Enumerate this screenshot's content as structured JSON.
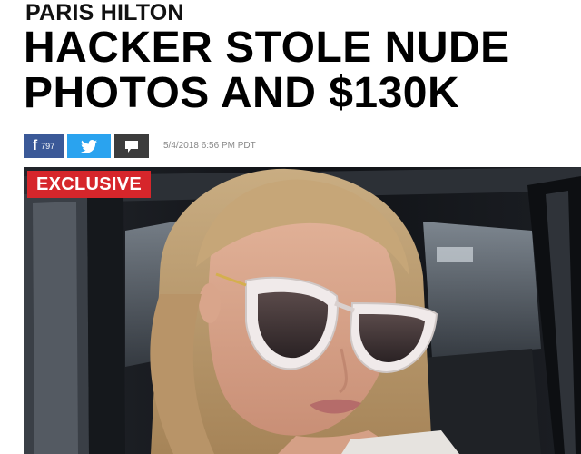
{
  "article": {
    "kicker": "PARIS HILTON",
    "headline": "HACKER STOLE NUDE PHOTOS AND $130K",
    "timestamp": "5/4/2018 6:56 PM PDT",
    "badge": "EXCLUSIVE"
  },
  "share": {
    "facebook_glyph": "f",
    "facebook_count": "797",
    "twitter_icon": "twitter-bird-icon",
    "comment_icon": "comment-bubble-icon"
  },
  "colors": {
    "facebook": "#3b5998",
    "twitter": "#2aa3ef",
    "comments": "#3c3c3c",
    "badge": "#d6262b"
  }
}
